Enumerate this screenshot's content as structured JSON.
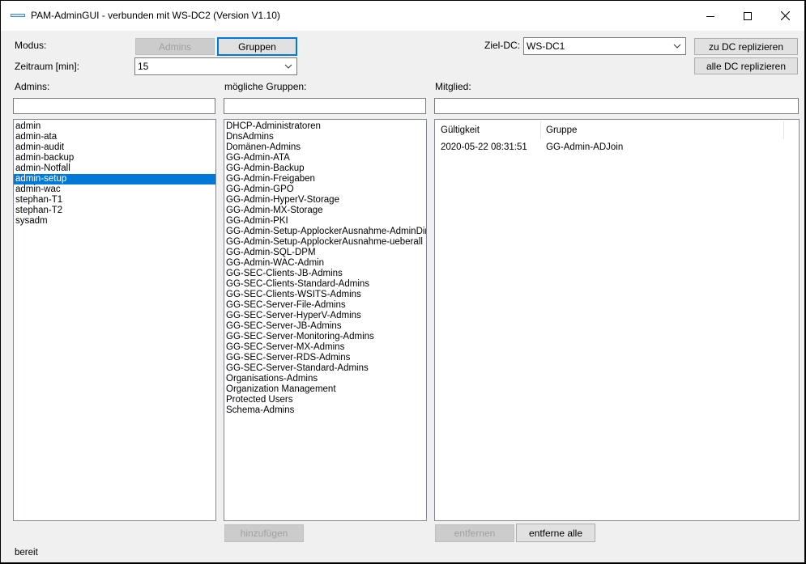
{
  "window": {
    "title": "PAM-AdminGUI - verbunden mit WS-DC2 (Version V1.10)"
  },
  "toolbar": {
    "modus_label": "Modus:",
    "admins_button": "Admins",
    "gruppen_button": "Gruppen",
    "zeitraum_label": "Zeitraum [min]:",
    "zeitraum_value": "15",
    "zieldc_label": "Ziel-DC:",
    "zieldc_value": "WS-DC1",
    "replicate_button": "zu DC replizieren",
    "replicate_all_button": "alle DC replizieren"
  },
  "admins": {
    "label": "Admins:",
    "filter": "",
    "items": [
      "admin",
      "admin-ata",
      "admin-audit",
      "admin-backup",
      "admin-Notfall",
      "admin-setup",
      "admin-wac",
      "stephan-T1",
      "stephan-T2",
      "sysadm"
    ],
    "selected": "admin-setup"
  },
  "groups": {
    "label": "mögliche Gruppen:",
    "filter": "",
    "items": [
      "DHCP-Administratoren",
      "DnsAdmins",
      "Domänen-Admins",
      "GG-Admin-ATA",
      "GG-Admin-Backup",
      "GG-Admin-Freigaben",
      "GG-Admin-GPO",
      "GG-Admin-HyperV-Storage",
      "GG-Admin-MX-Storage",
      "GG-Admin-PKI",
      "GG-Admin-Setup-ApplockerAusnahme-AdminDir",
      "GG-Admin-Setup-ApplockerAusnahme-ueberall",
      "GG-Admin-SQL-DPM",
      "GG-Admin-WAC-Admin",
      "GG-SEC-Clients-JB-Admins",
      "GG-SEC-Clients-Standard-Admins",
      "GG-SEC-Clients-WSITS-Admins",
      "GG-SEC-Server-File-Admins",
      "GG-SEC-Server-HyperV-Admins",
      "GG-SEC-Server-JB-Admins",
      "GG-SEC-Server-Monitoring-Admins",
      "GG-SEC-Server-MX-Admins",
      "GG-SEC-Server-RDS-Admins",
      "GG-SEC-Server-Standard-Admins",
      "Organisations-Admins",
      "Organization Management",
      "Protected Users",
      "Schema-Admins"
    ],
    "add_button": "hinzufügen"
  },
  "member": {
    "label": "Mitglied:",
    "filter": "",
    "columns": [
      "Gültigkeit",
      "Gruppe"
    ],
    "rows": [
      [
        "2020-05-22 08:31:51",
        "GG-Admin-ADJoin"
      ]
    ],
    "remove_button": "entfernen",
    "remove_all_button": "entferne alle"
  },
  "status": {
    "text": "bereit"
  },
  "icons": {
    "app": "app-window-icon",
    "minimize": "minimize-icon",
    "maximize": "maximize-icon",
    "close": "close-icon",
    "dropdown": "chevron-down-icon"
  },
  "colors": {
    "selection": "#0078d7",
    "focus_border": "#0078d7",
    "disabled_text": "#a0a0a0",
    "window_bg": "#f0f0f0"
  }
}
